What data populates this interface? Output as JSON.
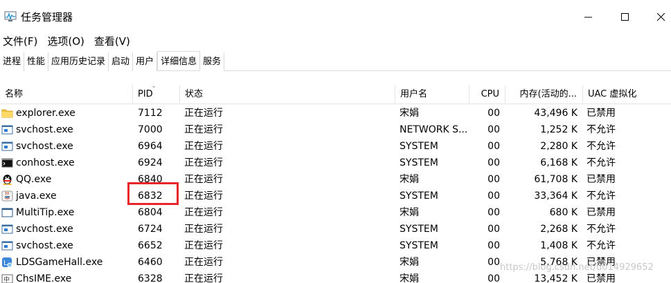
{
  "window": {
    "title": "任务管理器",
    "app_icon": "task-manager-icon"
  },
  "menu": [
    {
      "label": "文件(F)"
    },
    {
      "label": "选项(O)"
    },
    {
      "label": "查看(V)"
    }
  ],
  "tabs": [
    {
      "label": "进程",
      "active": false
    },
    {
      "label": "性能",
      "active": false
    },
    {
      "label": "应用历史记录",
      "active": false
    },
    {
      "label": "启动",
      "active": false
    },
    {
      "label": "用户",
      "active": false
    },
    {
      "label": "详细信息",
      "active": true
    },
    {
      "label": "服务",
      "active": false
    }
  ],
  "columns": {
    "name": "名称",
    "pid": "PID",
    "status": "状态",
    "user": "用户名",
    "cpu": "CPU",
    "memory": "内存(活动的...",
    "uac": "UAC 虚拟化"
  },
  "processes": [
    {
      "name": "explorer.exe",
      "icon": "folder-icon",
      "pid": "7112",
      "status": "正在运行",
      "user": "宋娟",
      "cpu": "00",
      "memory": "43,496 K",
      "uac": "已禁用"
    },
    {
      "name": "svchost.exe",
      "icon": "service-host-icon",
      "pid": "7000",
      "status": "正在运行",
      "user": "NETWORK S...",
      "cpu": "00",
      "memory": "1,252 K",
      "uac": "不允许"
    },
    {
      "name": "svchost.exe",
      "icon": "service-host-icon",
      "pid": "6964",
      "status": "正在运行",
      "user": "SYSTEM",
      "cpu": "00",
      "memory": "2,280 K",
      "uac": "不允许"
    },
    {
      "name": "conhost.exe",
      "icon": "console-icon",
      "pid": "6924",
      "status": "正在运行",
      "user": "SYSTEM",
      "cpu": "00",
      "memory": "6,168 K",
      "uac": "不允许"
    },
    {
      "name": "QQ.exe",
      "icon": "qq-penguin-icon",
      "pid": "6840",
      "status": "正在运行",
      "user": "宋娟",
      "cpu": "00",
      "memory": "61,708 K",
      "uac": "已禁用"
    },
    {
      "name": "java.exe",
      "icon": "java-icon",
      "pid": "6832",
      "status": "正在运行",
      "user": "SYSTEM",
      "cpu": "00",
      "memory": "33,364 K",
      "uac": "不允许"
    },
    {
      "name": "MultiTip.exe",
      "icon": "window-icon",
      "pid": "6804",
      "status": "正在运行",
      "user": "宋娟",
      "cpu": "00",
      "memory": "680 K",
      "uac": "已禁用"
    },
    {
      "name": "svchost.exe",
      "icon": "service-host-icon",
      "pid": "6724",
      "status": "正在运行",
      "user": "SYSTEM",
      "cpu": "00",
      "memory": "2,268 K",
      "uac": "不允许"
    },
    {
      "name": "svchost.exe",
      "icon": "service-host-icon",
      "pid": "6652",
      "status": "正在运行",
      "user": "SYSTEM",
      "cpu": "00",
      "memory": "1,408 K",
      "uac": "不允许"
    },
    {
      "name": "LDSGameHall.exe",
      "icon": "game-hall-icon",
      "pid": "6460",
      "status": "正在运行",
      "user": "宋娟",
      "cpu": "00",
      "memory": "5,768 K",
      "uac": "已禁用"
    },
    {
      "name": "ChsIME.exe",
      "icon": "ime-icon",
      "pid": "6328",
      "status": "正在运行",
      "user": "宋娟",
      "cpu": "00",
      "memory": "13,452 K",
      "uac": "已禁用"
    }
  ],
  "highlight_color": "#e8252b",
  "watermark": "https://blog.csdn.net/u014929652"
}
